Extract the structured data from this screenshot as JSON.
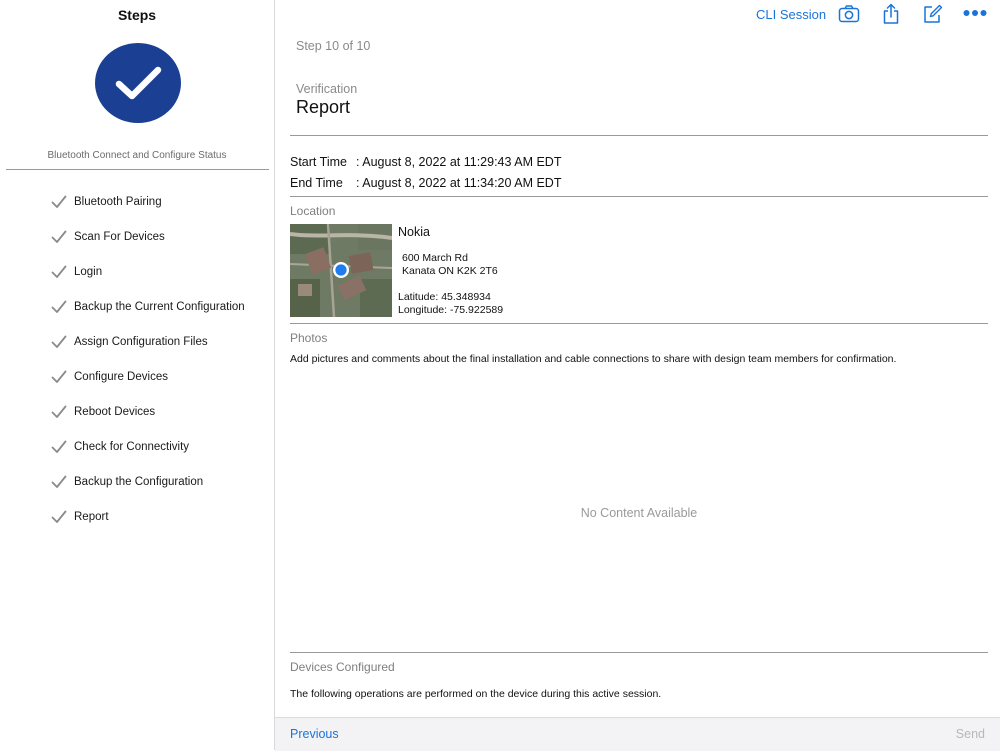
{
  "sidebar": {
    "title": "Steps",
    "status_subtitle": "Bluetooth Connect and Configure Status",
    "items": [
      {
        "label": "Bluetooth Pairing",
        "complete": true
      },
      {
        "label": "Scan For Devices",
        "complete": true
      },
      {
        "label": "Login",
        "complete": true
      },
      {
        "label": "Backup the Current Configuration",
        "complete": true
      },
      {
        "label": "Assign Configuration Files",
        "complete": true
      },
      {
        "label": "Configure Devices",
        "complete": true
      },
      {
        "label": "Reboot Devices",
        "complete": true
      },
      {
        "label": "Check for Connectivity",
        "complete": true
      },
      {
        "label": "Backup the Configuration",
        "complete": true
      },
      {
        "label": "Report",
        "complete": true
      }
    ]
  },
  "toolbar": {
    "cli_label": "CLI Session",
    "icons": [
      "camera-icon",
      "share-icon",
      "compose-icon",
      "more-icon"
    ]
  },
  "header": {
    "step_count": "Step 10 of 10",
    "kicker": "Verification",
    "title": "Report"
  },
  "times": {
    "start_key": "Start Time",
    "start_value": ": August 8, 2022 at 11:29:43 AM EDT",
    "end_key": "End Time",
    "end_value": ": August 8, 2022 at 11:34:20 AM EDT"
  },
  "location": {
    "section_label": "Location",
    "name": "Nokia",
    "address_line1": "600 March Rd",
    "address_line2": "Kanata ON K2K 2T6",
    "latitude": "Latitude: 45.348934",
    "longitude": "Longitude: -75.922589"
  },
  "photos": {
    "section_label": "Photos",
    "description": "Add pictures and comments about the final installation and cable connections to share with design team members for confirmation.",
    "empty_message": "No Content Available"
  },
  "devices": {
    "section_label": "Devices Configured",
    "description": "The following operations are performed on the device during this active session."
  },
  "footer": {
    "previous_label": "Previous",
    "send_label": "Send"
  },
  "colors": {
    "accent": "#1a74d8",
    "badge": "#1a3f93",
    "check_gray": "#8a8a8a"
  }
}
